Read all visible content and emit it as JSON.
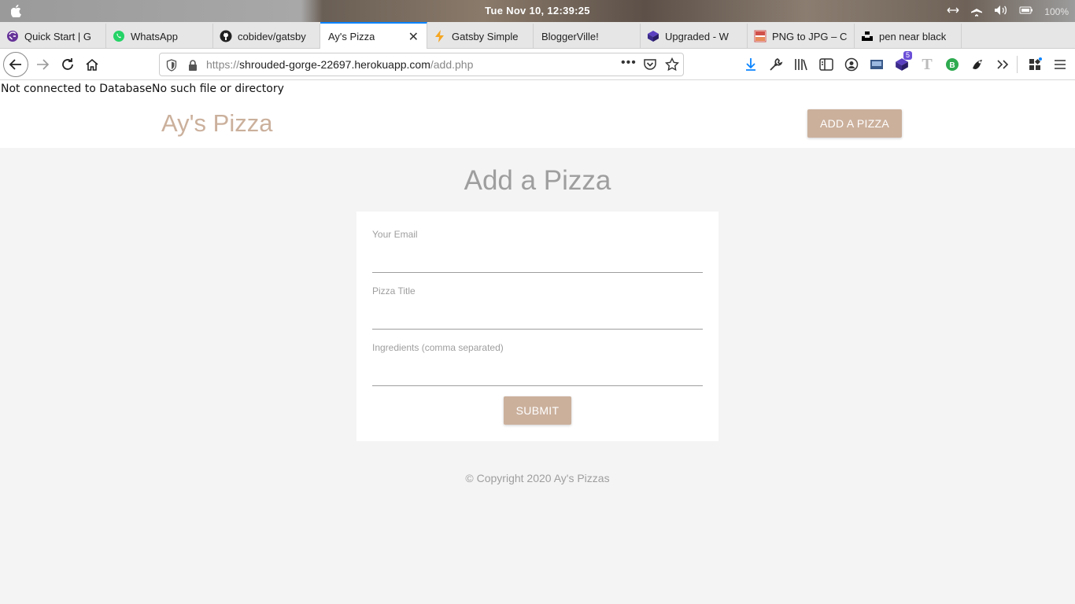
{
  "os": {
    "clock": "Tue Nov 10, 12:39:25",
    "battery": "100%"
  },
  "browser": {
    "tabs": [
      {
        "title": "Quick Start | G",
        "icon": "gatsby-icon"
      },
      {
        "title": "WhatsApp",
        "icon": "whatsapp-icon"
      },
      {
        "title": "cobidev/gatsby",
        "icon": "github-icon"
      },
      {
        "title": "Ay's Pizza",
        "icon": "none",
        "active": true
      },
      {
        "title": "Gatsby Simple",
        "icon": "lightning-icon"
      },
      {
        "title": "BloggerVille!",
        "icon": "none"
      },
      {
        "title": "Upgraded - W",
        "icon": "cube-icon"
      },
      {
        "title": "PNG to JPG – C",
        "icon": "png-jpg-icon"
      },
      {
        "title": "pen near black",
        "icon": "unsplash-icon"
      }
    ],
    "url_prefix": "https://",
    "url_host": "shrouded-gorge-22697.herokuapp.com",
    "url_path": "/add.php",
    "extension_badge": "5"
  },
  "page": {
    "error_text": "Not connected to DatabaseNo such file or directory",
    "brand": "Ay's Pizza",
    "add_button": "ADD A PIZZA",
    "title": "Add a Pizza",
    "form": {
      "email_label": "Your Email",
      "email_value": "",
      "title_label": "Pizza Title",
      "title_value": "",
      "ingredients_label": "Ingredients (comma separated)",
      "ingredients_value": "",
      "submit_label": "SUBMIT"
    },
    "footer": "© Copyright 2020 Ay's Pizzas"
  },
  "colors": {
    "accent": "#cbb09c",
    "muted_text": "#9e9e9e",
    "page_bg": "#f4f4f4",
    "active_tab_line": "#0a84ff"
  }
}
